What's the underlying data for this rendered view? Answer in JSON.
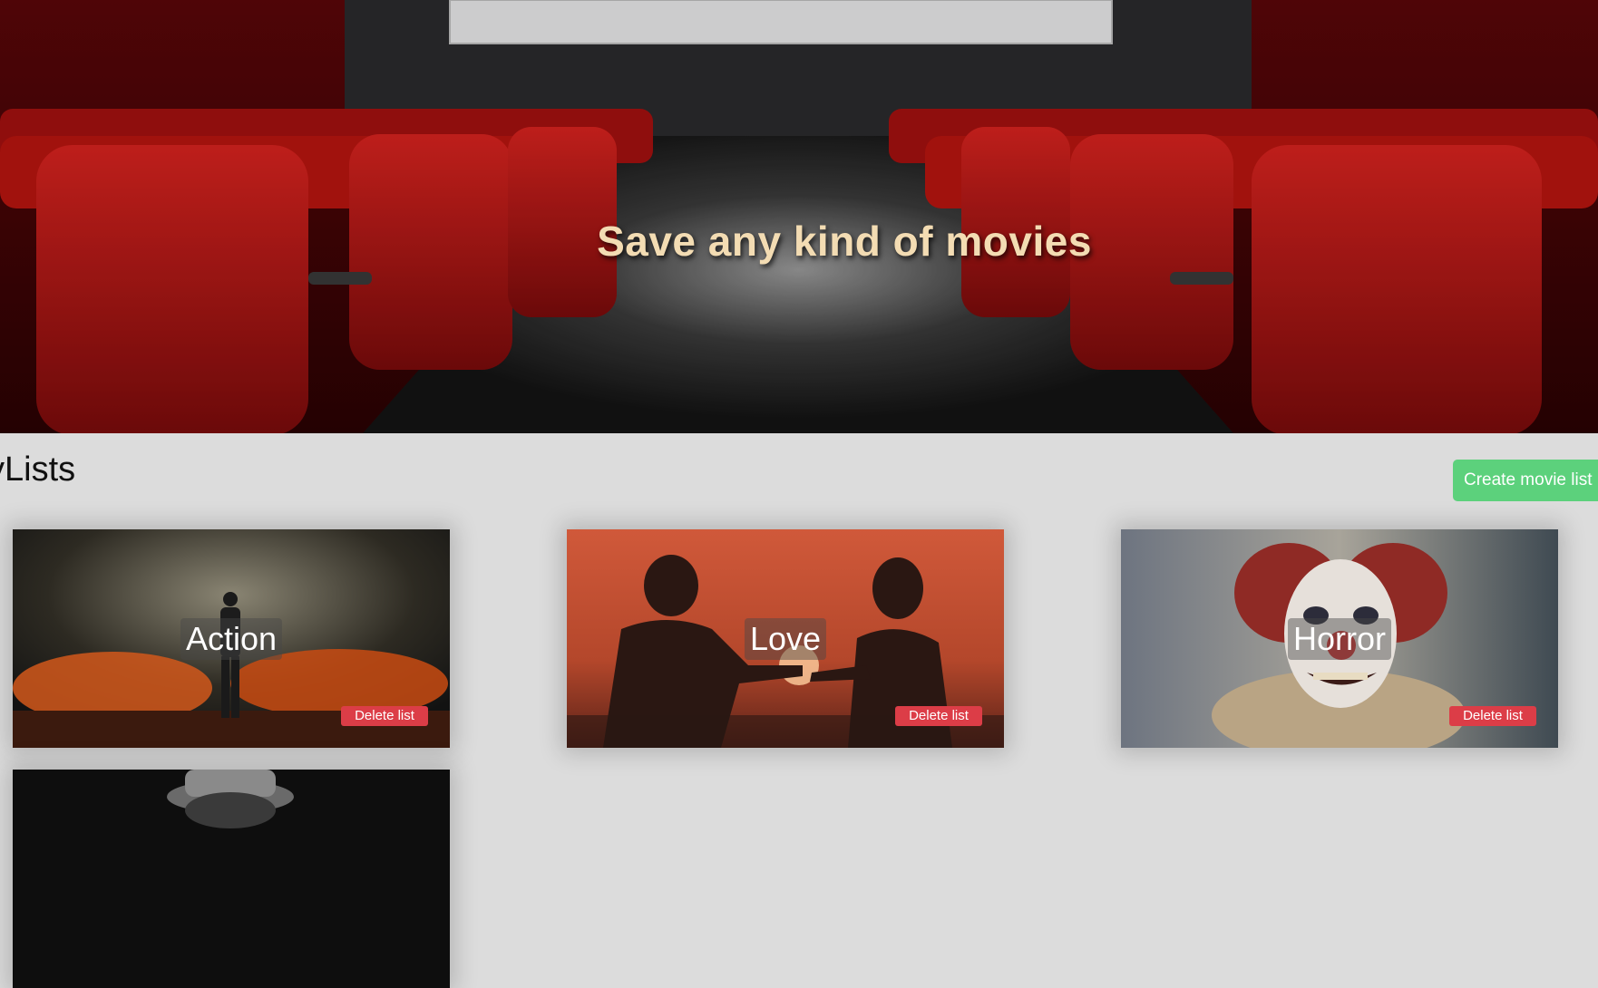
{
  "hero": {
    "title": "Save any kind of movies"
  },
  "lists_section": {
    "title": "yLists",
    "create_button_label": "Create movie list"
  },
  "lists": [
    {
      "name": "Action",
      "delete_label": "Delete list",
      "image": "man-standing-before-explosion"
    },
    {
      "name": "Love",
      "delete_label": "Delete list",
      "image": "couple-silhouettes-sunset-heart"
    },
    {
      "name": "Horror",
      "delete_label": "Delete list",
      "image": "creepy-clown-face"
    },
    {
      "name": "",
      "delete_label": "",
      "image": "black-and-white-hat"
    }
  ],
  "colors": {
    "page_bg": "#dcdcdc",
    "hero_title": "#f3dcb3",
    "create_button": "#5cd17c",
    "delete_button": "#dc3d47"
  }
}
